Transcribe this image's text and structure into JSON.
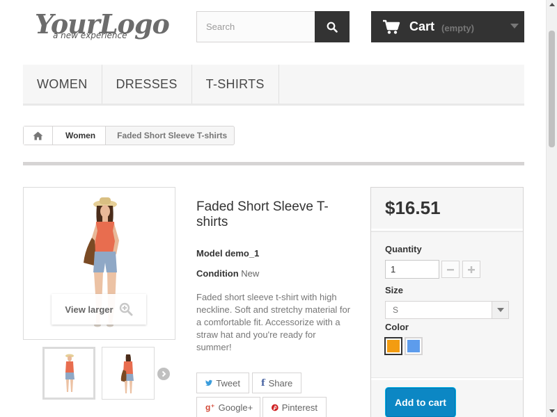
{
  "header": {
    "logo_main": "YourLogo",
    "logo_tagline": "a new experience",
    "search_placeholder": "Search",
    "cart_label": "Cart",
    "cart_status": "(empty)"
  },
  "menu": {
    "items": [
      {
        "label": "WOMEN"
      },
      {
        "label": "DRESSES"
      },
      {
        "label": "T-SHIRTS"
      }
    ]
  },
  "breadcrumb": {
    "category": "Women",
    "current": "Faded Short Sleeve T-shirts"
  },
  "gallery": {
    "view_larger_label": "View larger"
  },
  "product": {
    "title": "Faded Short Sleeve T-shirts",
    "model_label": "Model",
    "model_value": "demo_1",
    "condition_label": "Condition",
    "condition_value": "New",
    "description": "Faded short sleeve t-shirt with high neckline. Soft and stretchy material for a comfortable fit. Accessorize with a straw hat and you're ready for summer!"
  },
  "share": {
    "tweet": "Tweet",
    "share": "Share",
    "google": "Google+",
    "pinterest": "Pinterest"
  },
  "buybox": {
    "price": "$16.51",
    "quantity_label": "Quantity",
    "quantity_value": "1",
    "size_label": "Size",
    "size_value": "S",
    "color_label": "Color",
    "colors": [
      {
        "name": "orange",
        "hex": "#f39c11",
        "selected": true
      },
      {
        "name": "blue",
        "hex": "#5d9cec",
        "selected": false
      }
    ],
    "add_to_cart": "Add to cart"
  },
  "theme": {
    "accent_dark": "#333333",
    "button_blue": "#0c87c4"
  }
}
